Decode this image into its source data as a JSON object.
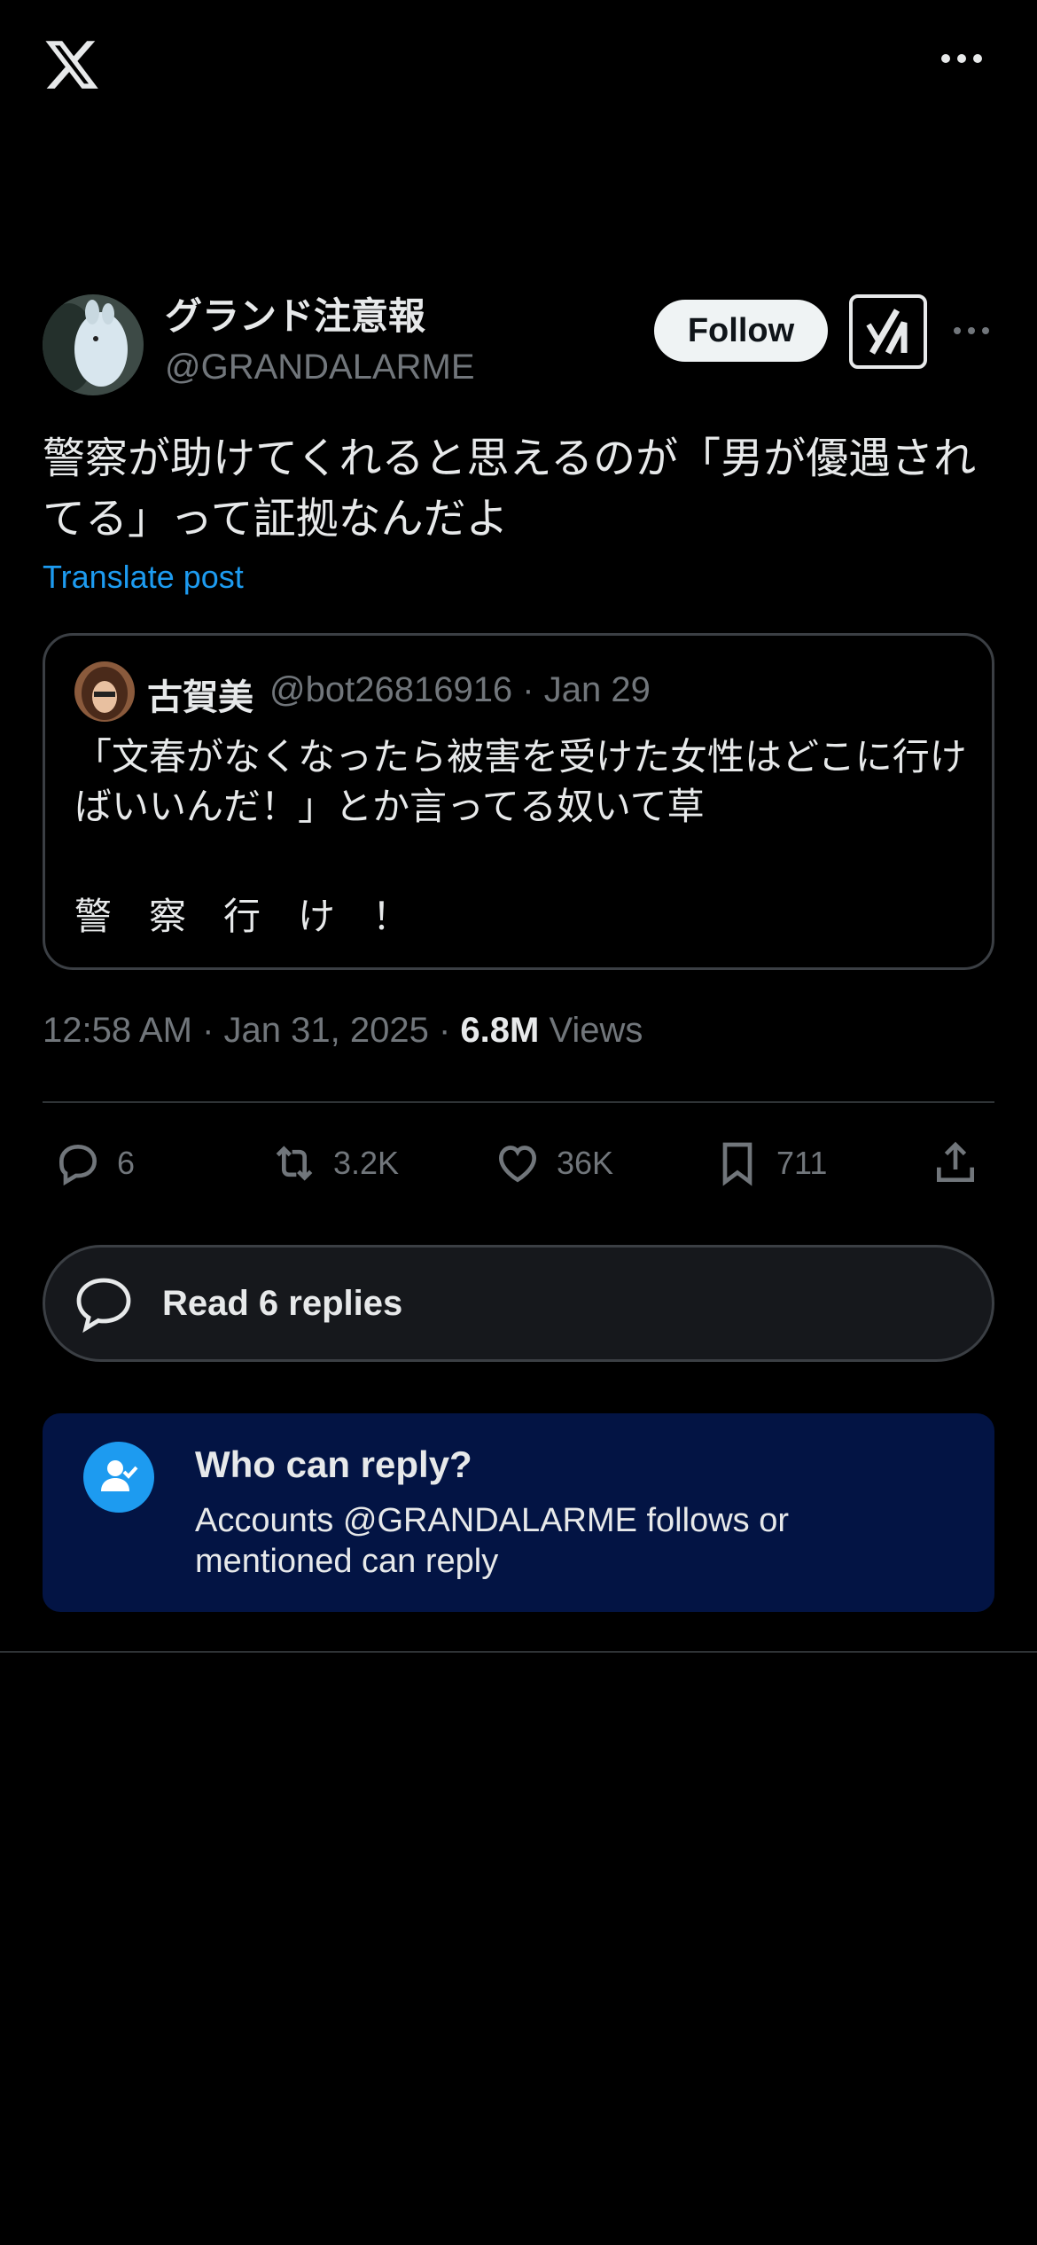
{
  "header": {
    "logo_icon": "x-logo-icon",
    "more_icon": "more-horizontal-icon"
  },
  "post": {
    "author": {
      "display_name": "グランド注意報",
      "handle": "@GRANDALARME",
      "avatar_icon": "avatar"
    },
    "follow_label": "Follow",
    "grok_icon": "grok-icon",
    "text": "警察が助けてくれると思えるのが「男が優遇されてる」って証拠なんだよ",
    "translate_label": "Translate post",
    "quote": {
      "name": "古賀美",
      "handle_date": "@bot26816916 · Jan 29",
      "text": "「文春がなくなったら被害を受けた女性はどこに行けばいいんだ！」とか言ってる奴いて草",
      "text2": "警察行け！"
    },
    "meta": {
      "timestamp": "12:58 AM · Jan 31, 2025 · ",
      "views_count": "6.8M",
      "views_label": " Views"
    },
    "actions": {
      "replies": "6",
      "reposts": "3.2K",
      "likes": "36K",
      "bookmarks": "711"
    }
  },
  "read_replies_label": "Read 6 replies",
  "who_can_reply": {
    "title": "Who can reply?",
    "description": "Accounts @GRANDALARME follows or mentioned can reply"
  },
  "colors": {
    "accent": "#1d9bf0",
    "background": "#000000",
    "banner": "#031444"
  }
}
